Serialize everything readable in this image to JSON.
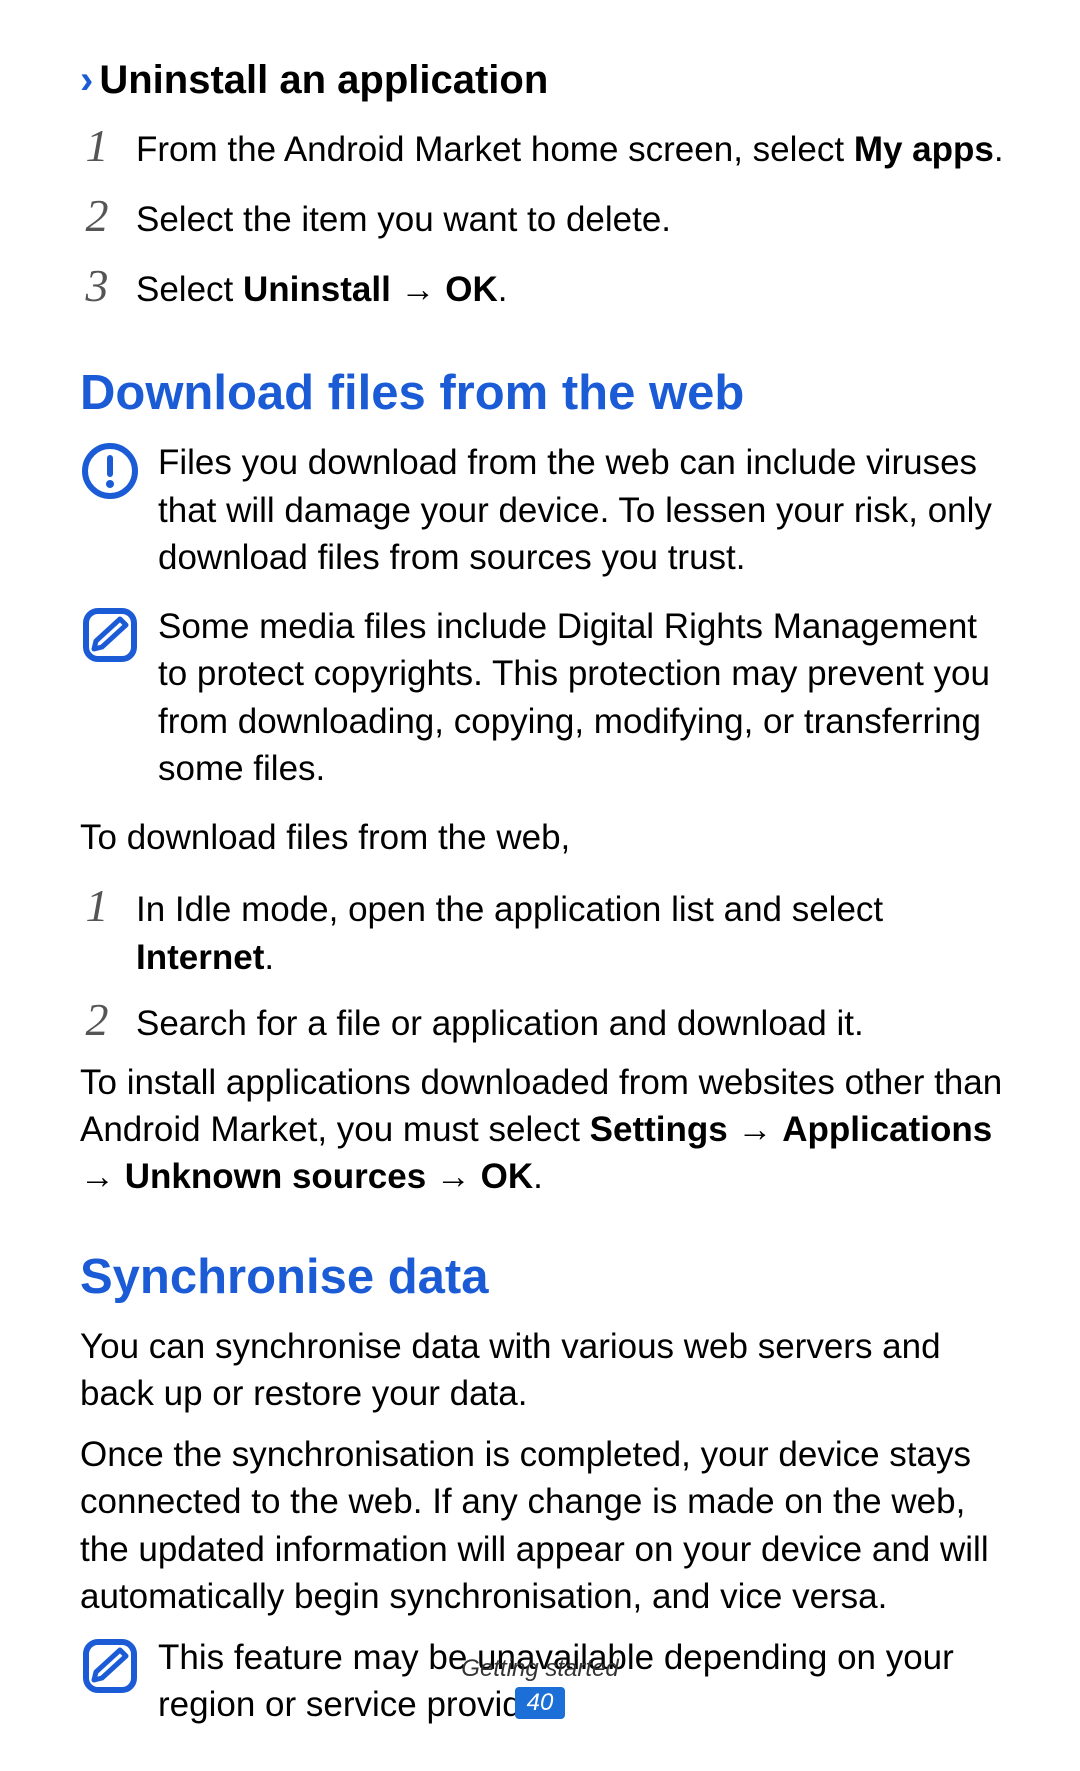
{
  "uninstall": {
    "chevron": "›",
    "heading": "Uninstall an application",
    "steps": {
      "n1": "1",
      "s1a": "From the Android Market home screen, select ",
      "s1b": "My apps",
      "s1c": ".",
      "n2": "2",
      "s2": "Select the item you want to delete.",
      "n3": "3",
      "s3a": "Select ",
      "s3b": "Uninstall",
      "s3arrow": " → ",
      "s3c": "OK",
      "s3d": "."
    }
  },
  "download": {
    "heading": "Download files from the web",
    "warn": "Files you download from the web can include viruses that will damage your device. To lessen your risk, only download files from sources you trust.",
    "note": "Some media files include Digital Rights Management to protect copyrights. This protection may prevent you from downloading, copying, modifying, or transferring some files.",
    "intro": "To download files from the web,",
    "n1": "1",
    "s1a": "In Idle mode, open the application list and select ",
    "s1b": "Internet",
    "s1c": ".",
    "n2": "2",
    "s2": "Search for a file or application and download it.",
    "post_a": "To install applications downloaded from websites other than Android Market, you must select ",
    "post_b": "Settings",
    "arrow1": " → ",
    "post_c": "Applications",
    "arrow2": " → ",
    "post_d": "Unknown sources",
    "arrow3": " → ",
    "post_e": "OK",
    "post_f": "."
  },
  "sync": {
    "heading": "Synchronise data",
    "p1": "You can synchronise data with various web servers and back up or restore your data.",
    "p2": "Once the synchronisation is completed, your device stays connected to the web. If any change is made on the web, the updated information will appear on your device and will automatically begin synchronisation, and vice versa.",
    "note": "This feature may be unavailable depending on your region or service provider."
  },
  "footer": {
    "section": "Getting started",
    "page": "40"
  }
}
